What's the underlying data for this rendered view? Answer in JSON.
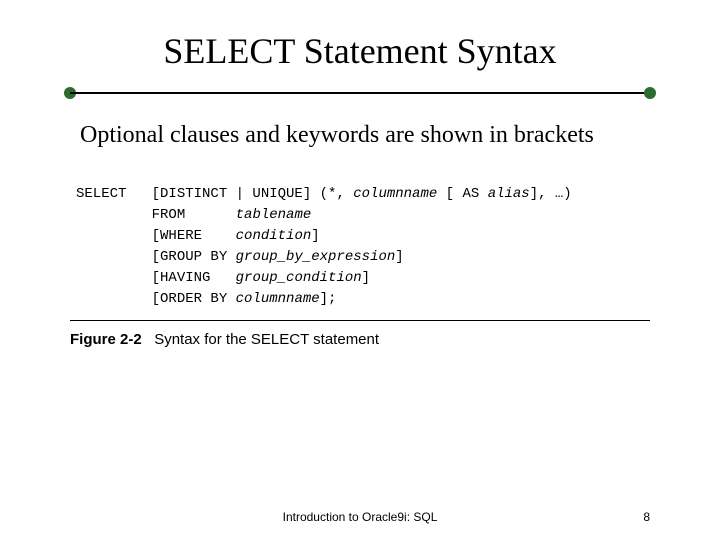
{
  "title": "SELECT Statement Syntax",
  "body": "Optional clauses and keywords are shown in brackets",
  "code": {
    "l1a": "SELECT   [DISTINCT | UNIQUE] (*, ",
    "l1b": "columnname",
    "l1c": " [ AS ",
    "l1d": "alias",
    "l1e": "], …)",
    "l2a": "         FROM      ",
    "l2b": "tablename",
    "l3a": "         [WHERE    ",
    "l3b": "condition",
    "l3c": "]",
    "l4a": "         [GROUP BY ",
    "l4b": "group_by_expression",
    "l4c": "]",
    "l5a": "         [HAVING   ",
    "l5b": "group_condition",
    "l5c": "]",
    "l6a": "         [ORDER BY ",
    "l6b": "columnname",
    "l6c": "];"
  },
  "figure": {
    "label": "Figure 2-2",
    "caption": "Syntax for the SELECT statement"
  },
  "footer": {
    "center": "Introduction to Oracle9i: SQL",
    "page": "8"
  }
}
